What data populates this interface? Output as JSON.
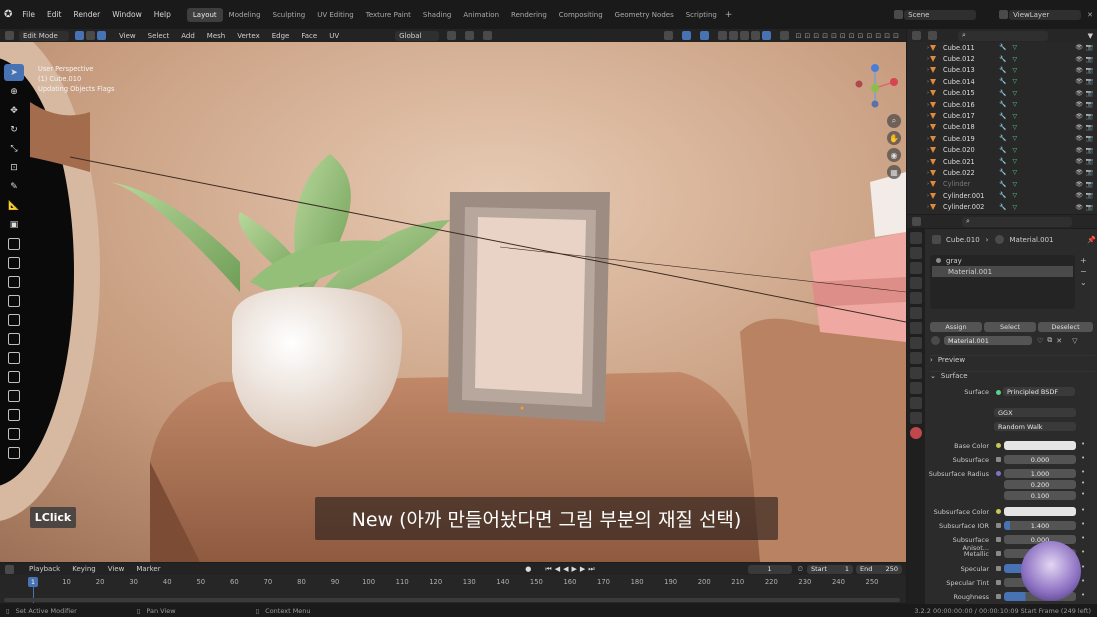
{
  "menubar": {
    "menus": [
      "File",
      "Edit",
      "Render",
      "Window",
      "Help"
    ],
    "workspaces": [
      {
        "label": "Layout",
        "active": true
      },
      {
        "label": "Modeling"
      },
      {
        "label": "Sculpting"
      },
      {
        "label": "UV Editing"
      },
      {
        "label": "Texture Paint"
      },
      {
        "label": "Shading"
      },
      {
        "label": "Animation"
      },
      {
        "label": "Rendering"
      },
      {
        "label": "Compositing"
      },
      {
        "label": "Geometry Nodes"
      },
      {
        "label": "Scripting"
      }
    ],
    "add_tab": "+",
    "scene": "Scene",
    "view_layer": "ViewLayer"
  },
  "viewport_header": {
    "mode": "Edit Mode",
    "menus": [
      "View",
      "Select",
      "Add",
      "Mesh",
      "Vertex",
      "Edge",
      "Face",
      "UV"
    ],
    "transform": "Global",
    "axes": "X Y Z",
    "options": "Options"
  },
  "viewport": {
    "info_lines": [
      "User Perspective",
      "(1) Cube.010",
      "Updating Objects Flags"
    ],
    "subtitle": "New (아까 만들어놨다면 그림 부분의 재질 선택)",
    "key_overlay": "LClick"
  },
  "timeline": {
    "menus": [
      "Playback",
      "Keying",
      "View",
      "Marker"
    ],
    "current_frame": "1",
    "start_label": "Start",
    "start": "1",
    "end_label": "End",
    "end": "250",
    "frames": [
      "1",
      "10",
      "20",
      "30",
      "40",
      "50",
      "60",
      "70",
      "80",
      "90",
      "100",
      "110",
      "120",
      "130",
      "140",
      "150",
      "160",
      "170",
      "180",
      "190",
      "200",
      "210",
      "220",
      "230",
      "240",
      "250"
    ]
  },
  "statusbar": {
    "left": "Set Active Modifier",
    "middle": "Pan View",
    "right": "Context Menu",
    "version": "3.2.2  00:00:00:00 / 00:00:10:09  Start Frame (249 left)"
  },
  "outliner": {
    "rows": [
      {
        "name": "Cube.011"
      },
      {
        "name": "Cube.012"
      },
      {
        "name": "Cube.013"
      },
      {
        "name": "Cube.014"
      },
      {
        "name": "Cube.015"
      },
      {
        "name": "Cube.016"
      },
      {
        "name": "Cube.017"
      },
      {
        "name": "Cube.018"
      },
      {
        "name": "Cube.019"
      },
      {
        "name": "Cube.020"
      },
      {
        "name": "Cube.021"
      },
      {
        "name": "Cube.022"
      },
      {
        "name": "Cylinder",
        "dim": true
      },
      {
        "name": "Cylinder.001"
      },
      {
        "name": "Cylinder.002"
      },
      {
        "name": "Cylinder.003"
      }
    ]
  },
  "properties": {
    "breadcrumb_object": "Cube.010",
    "breadcrumb_material": "Material.001",
    "slots": [
      "gray",
      "Material.001"
    ],
    "assign": "Assign",
    "select": "Select",
    "deselect": "Deselect",
    "material_name": "Material.001",
    "preview": "Preview",
    "surface_section": "Surface",
    "surface_label": "Surface",
    "surface_value": "Principled BSDF",
    "distribution": "GGX",
    "subsurface_method": "Random Walk",
    "fields": [
      {
        "label": "Base Color",
        "value": "",
        "kind": "white",
        "dot": "yellow"
      },
      {
        "label": "Subsurface",
        "value": "0.000",
        "kind": "normal",
        "dot": "gray"
      },
      {
        "label": "Subsurface Radius",
        "value": "1.000",
        "kind": "normal",
        "dot": "purple"
      },
      {
        "label": "",
        "value": "0.200",
        "kind": "normal",
        "dot": ""
      },
      {
        "label": "",
        "value": "0.100",
        "kind": "normal",
        "dot": ""
      },
      {
        "label": "Subsurface Color",
        "value": "",
        "kind": "white",
        "dot": "yellow"
      },
      {
        "label": "Subsurface IOR",
        "value": "1.400",
        "kind": "normal",
        "dot": "gray"
      },
      {
        "label": "Subsurface Anisot...",
        "value": "0.000",
        "kind": "normal",
        "dot": "gray"
      },
      {
        "label": "Metallic",
        "value": "",
        "kind": "normal",
        "dot": "gray"
      },
      {
        "label": "Specular",
        "value": "",
        "kind": "blue",
        "dot": "gray"
      },
      {
        "label": "Specular Tint",
        "value": "",
        "kind": "normal",
        "dot": "gray"
      },
      {
        "label": "Roughness",
        "value": "",
        "kind": "blue",
        "dot": "gray"
      }
    ]
  }
}
